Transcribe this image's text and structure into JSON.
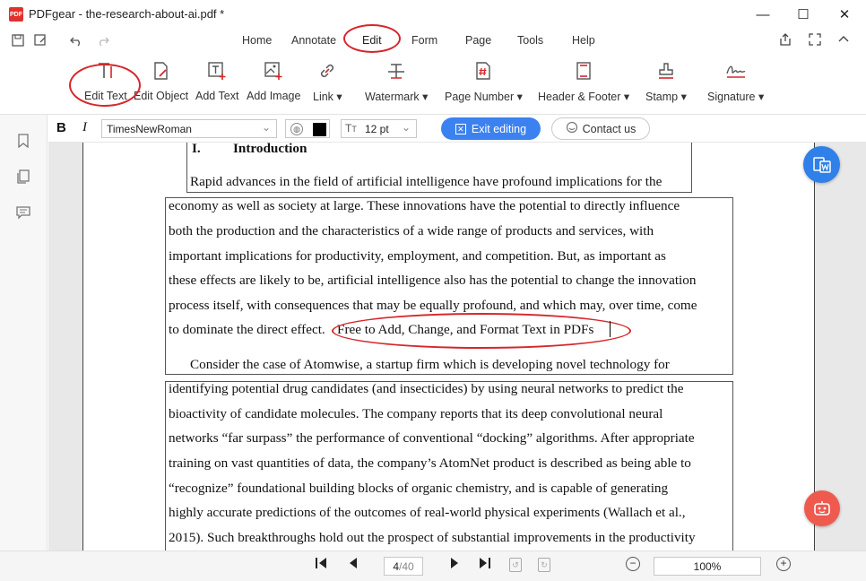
{
  "window": {
    "logo_text": "PDF",
    "title": "PDFgear - the-research-about-ai.pdf *",
    "minimize": "—",
    "maximize": "☐",
    "close": "✕"
  },
  "menu": {
    "items": [
      "Home",
      "Annotate",
      "Edit",
      "Form",
      "Page",
      "Tools",
      "Help"
    ],
    "active": "Edit"
  },
  "ribbon": {
    "tools": [
      {
        "label": "Edit Text",
        "icon": "edit-text-icon"
      },
      {
        "label": "Edit Object",
        "icon": "edit-object-icon"
      },
      {
        "label": "Add Text",
        "icon": "add-text-icon"
      },
      {
        "label": "Add Image",
        "icon": "add-image-icon"
      },
      {
        "label": "Link ▾",
        "icon": "link-icon"
      },
      {
        "label": "Watermark ▾",
        "icon": "watermark-icon"
      },
      {
        "label": "Page Number ▾",
        "icon": "page-number-icon"
      },
      {
        "label": "Header & Footer ▾",
        "icon": "header-footer-icon"
      },
      {
        "label": "Stamp ▾",
        "icon": "stamp-icon"
      },
      {
        "label": "Signature ▾",
        "icon": "signature-icon"
      }
    ]
  },
  "format_toolbar": {
    "bold_label": "B",
    "italic_label": "I",
    "font_family": "TimesNewRoman",
    "font_size": "12 pt",
    "text_color": "#000000",
    "exit_label": "Exit editing",
    "contact_label": "Contact us"
  },
  "document": {
    "heading_number": "I.",
    "heading_title": "Introduction",
    "para1_first_line": "Rapid advances in the field of artificial intelligence have profound implications for the",
    "para1_lines": [
      "economy as well as society at large.  These innovations have the potential to directly influence",
      "both the production and the characteristics of a wide range of products and services, with",
      "important implications for productivity, employment, and competition.  But, as important as",
      "these effects are likely to be, artificial intelligence also has the potential to change the innovation",
      "process itself, with consequences that may be equally profound, and which may, over time, come"
    ],
    "para1_last_prefix": "to dominate the direct effect.",
    "inserted_text": "Free to Add, Change, and Format Text in PDFs",
    "para2_first_line": "Consider the case of Atomwise, a startup firm which is developing novel technology for",
    "para2_lines": [
      "identifying potential drug candidates (and insecticides) by using neural networks to predict the",
      "bioactivity of candidate molecules.  The company reports that its deep convolutional neural",
      "networks “far surpass” the performance of conventional “docking” algorithms.  After appropriate",
      "training on vast quantities of data, the company’s AtomNet product is described as being able to",
      "“recognize” foundational building blocks of organic chemistry, and is capable of generating",
      "highly accurate predictions of the outcomes of real-world physical experiments (Wallach et al.,",
      "2015).  Such breakthroughs hold out the prospect of substantial improvements in the productivity"
    ]
  },
  "statusbar": {
    "current_page": "4",
    "total_pages": "/40",
    "zoom": "100%"
  },
  "colors": {
    "accent": "#3b82f0",
    "highlight_circle": "#d6262a",
    "assistant_fab": "#ef5a4f"
  }
}
